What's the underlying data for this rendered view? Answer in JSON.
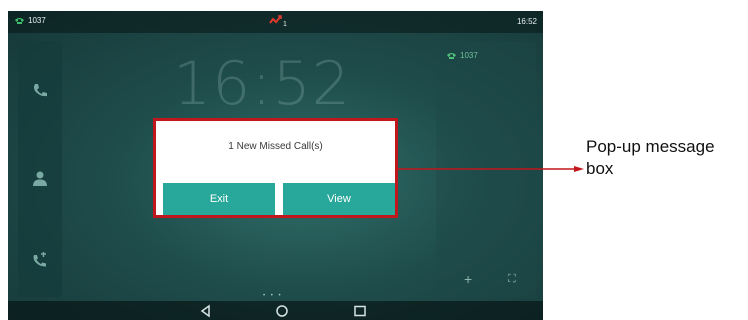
{
  "status_bar": {
    "extension": "1037",
    "time": "16:52",
    "missed_count": "1"
  },
  "home": {
    "big_clock": "16:52",
    "account_label": "1037"
  },
  "popup": {
    "message": "1 New Missed Call(s)",
    "exit_label": "Exit",
    "view_label": "View"
  },
  "annotation": {
    "text": "Pop-up message box"
  },
  "colors": {
    "frame": "#c0171c",
    "button": "#27a89a",
    "screen_bg": "#1f4d4c",
    "accent_green": "#6fbf9a"
  },
  "icons": {
    "status": "handset-icon",
    "missed": "missed-call-icon",
    "left_panel": [
      "phone-icon",
      "contact-icon",
      "call-history-icon"
    ],
    "right_panel": [
      "add-icon",
      "fullscreen-icon"
    ],
    "nav": [
      "back-icon",
      "home-icon",
      "recent-apps-icon"
    ]
  }
}
